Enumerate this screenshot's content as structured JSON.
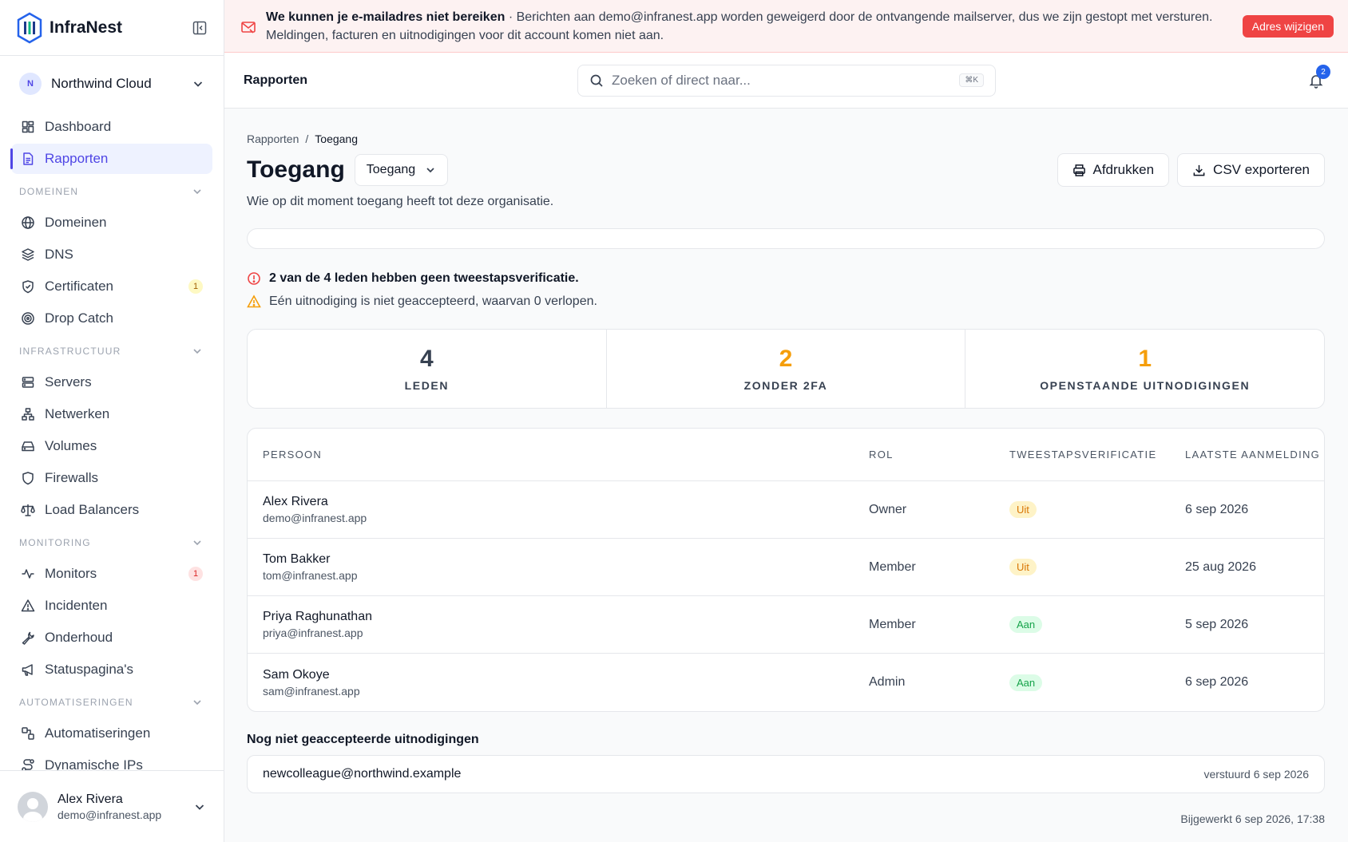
{
  "app": {
    "name": "InfraNest"
  },
  "org": {
    "initial": "N",
    "name": "Northwind Cloud"
  },
  "nav": {
    "top": [
      {
        "label": "Dashboard",
        "icon": "dashboard-icon"
      },
      {
        "label": "Rapporten",
        "icon": "file-text-icon",
        "active": true
      }
    ],
    "sections": [
      {
        "title": "DOMEINEN",
        "items": [
          {
            "label": "Domeinen",
            "icon": "globe-icon"
          },
          {
            "label": "DNS",
            "icon": "layers-icon"
          },
          {
            "label": "Certificaten",
            "icon": "shield-check-icon",
            "badge": "1",
            "badge_color": "yellow"
          },
          {
            "label": "Drop Catch",
            "icon": "target-icon"
          }
        ]
      },
      {
        "title": "INFRASTRUCTUUR",
        "items": [
          {
            "label": "Servers",
            "icon": "server-icon"
          },
          {
            "label": "Netwerken",
            "icon": "network-icon"
          },
          {
            "label": "Volumes",
            "icon": "hard-drive-icon"
          },
          {
            "label": "Firewalls",
            "icon": "shield-icon"
          },
          {
            "label": "Load Balancers",
            "icon": "scale-icon"
          }
        ]
      },
      {
        "title": "MONITORING",
        "items": [
          {
            "label": "Monitors",
            "icon": "activity-icon",
            "badge": "1",
            "badge_color": "red"
          },
          {
            "label": "Incidenten",
            "icon": "alert-triangle-icon"
          },
          {
            "label": "Onderhoud",
            "icon": "wrench-icon"
          },
          {
            "label": "Statuspagina's",
            "icon": "megaphone-icon"
          }
        ]
      },
      {
        "title": "AUTOMATISERINGEN",
        "items": [
          {
            "label": "Automatiseringen",
            "icon": "workflow-icon"
          },
          {
            "label": "Dynamische IPs",
            "icon": "route-icon"
          }
        ]
      }
    ]
  },
  "user": {
    "name": "Alex Rivera",
    "email": "demo@infranest.app"
  },
  "banner": {
    "title": "We kunnen je e-mailadres niet bereiken",
    "text": " · Berichten aan demo@infranest.app worden geweigerd door de ontvangende mailserver, dus we zijn gestopt met versturen. Meldingen, facturen en uitnodigingen voor dit account komen niet aan.",
    "button": "Adres wijzigen"
  },
  "topbar": {
    "title": "Rapporten",
    "search_placeholder": "Zoeken of direct naar...",
    "shortcut": "⌘K",
    "notifications": "2"
  },
  "breadcrumb": {
    "parent": "Rapporten",
    "sep": "/",
    "current": "Toegang"
  },
  "page": {
    "title": "Toegang",
    "selector": "Toegang",
    "print": "Afdrukken",
    "export": "CSV exporteren",
    "subtitle": "Wie op dit moment toegang heeft tot deze organisatie."
  },
  "alerts": {
    "error": "2 van de 4 leden hebben geen tweestapsverificatie.",
    "warning": "Eén uitnodiging is niet geaccepteerd, waarvan 0 verlopen."
  },
  "stats": [
    {
      "value": "4",
      "label": "LEDEN",
      "color": "#374151"
    },
    {
      "value": "2",
      "label": "ZONDER 2FA",
      "color": "#f59e0b"
    },
    {
      "value": "1",
      "label": "OPENSTAANDE UITNODIGINGEN",
      "color": "#f59e0b"
    }
  ],
  "table": {
    "headers": {
      "person": "PERSOON",
      "role": "ROL",
      "twofa": "TWEESTAPSVERIFICATIE",
      "last": "LAATSTE AANMELDING"
    },
    "rows": [
      {
        "name": "Alex Rivera",
        "email": "demo@infranest.app",
        "role": "Owner",
        "twofa": "Uit",
        "twofa_on": false,
        "last": "6 sep 2026"
      },
      {
        "name": "Tom Bakker",
        "email": "tom@infranest.app",
        "role": "Member",
        "twofa": "Uit",
        "twofa_on": false,
        "last": "25 aug 2026"
      },
      {
        "name": "Priya Raghunathan",
        "email": "priya@infranest.app",
        "role": "Member",
        "twofa": "Aan",
        "twofa_on": true,
        "last": "5 sep 2026"
      },
      {
        "name": "Sam Okoye",
        "email": "sam@infranest.app",
        "role": "Admin",
        "twofa": "Aan",
        "twofa_on": true,
        "last": "6 sep 2026"
      }
    ]
  },
  "invites": {
    "title": "Nog niet geaccepteerde uitnodigingen",
    "items": [
      {
        "email": "newcolleague@northwind.example",
        "sent": "verstuurd 6 sep 2026"
      }
    ]
  },
  "updated": "Bijgewerkt 6 sep 2026, 17:38"
}
